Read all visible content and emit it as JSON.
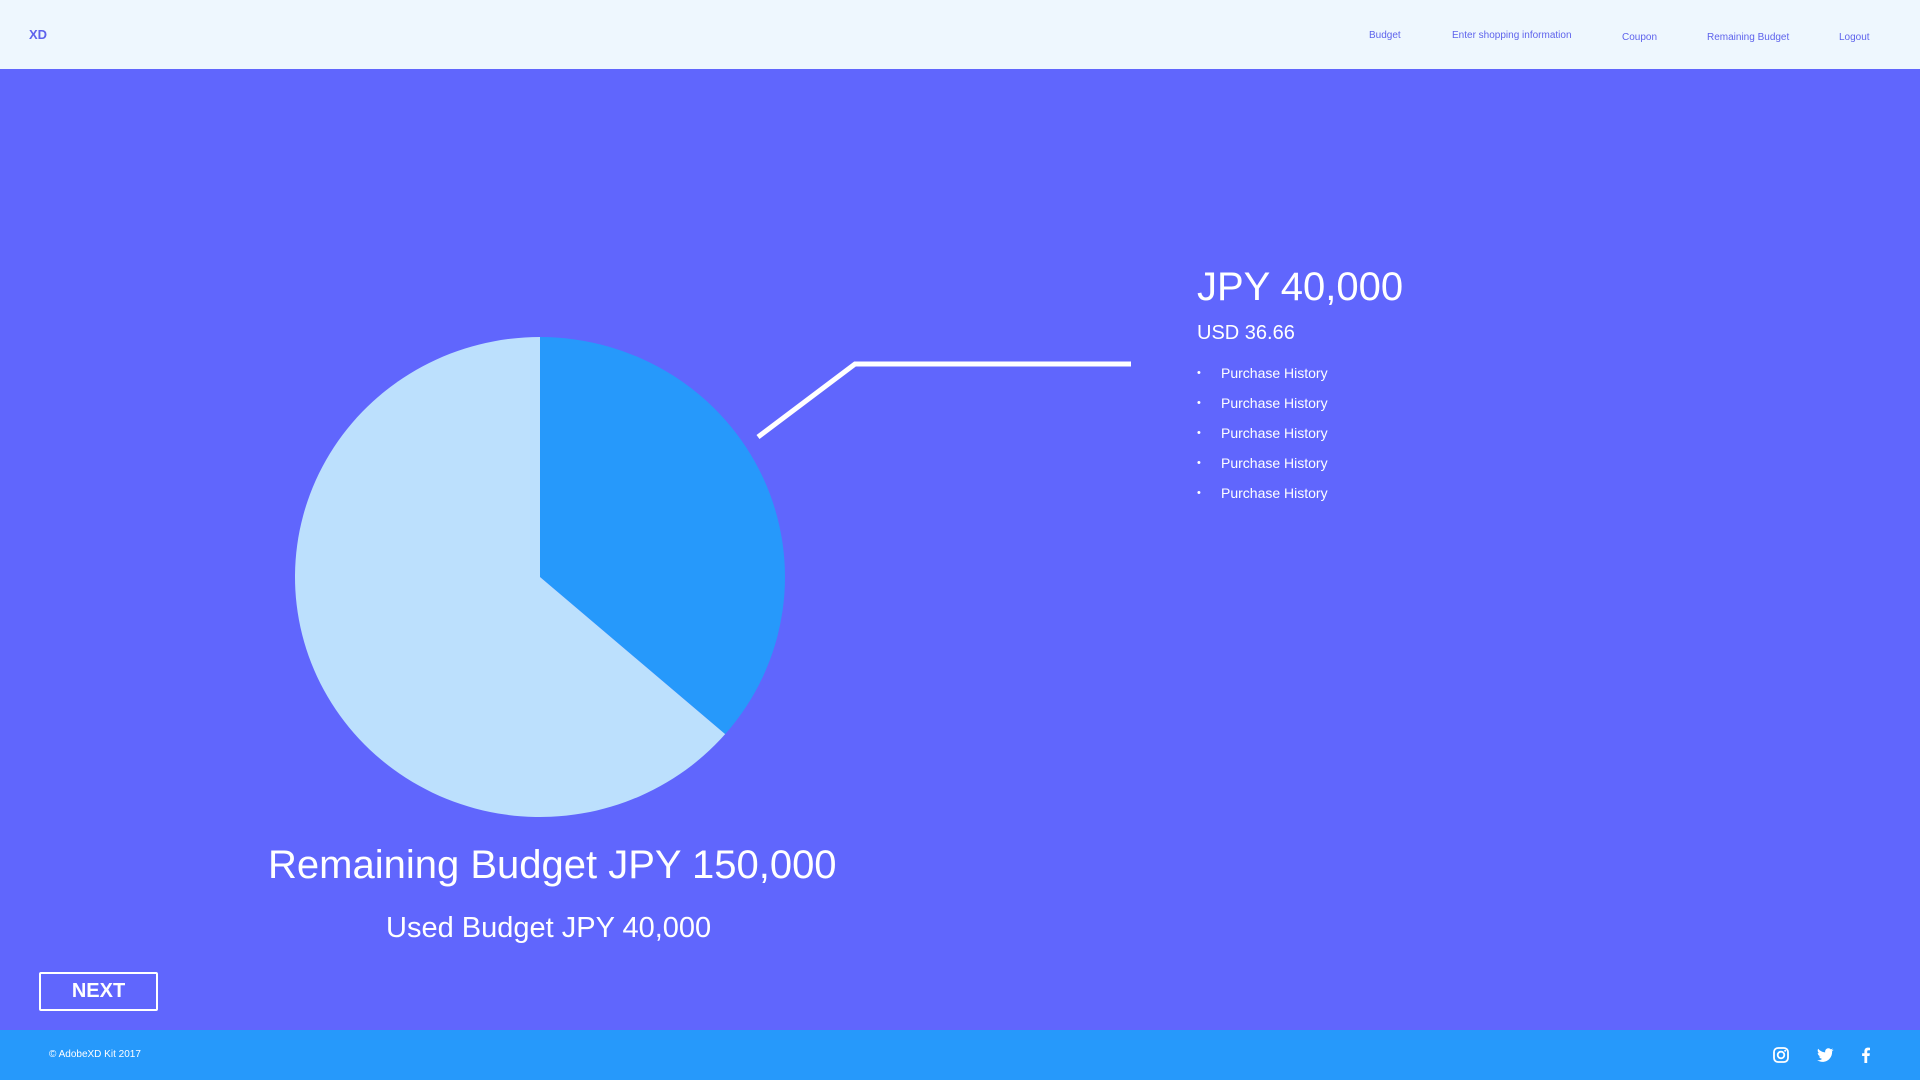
{
  "header": {
    "logo": "XD",
    "nav": [
      "Budget",
      "Enter shopping information",
      "Coupon",
      "Remaining Budget",
      "Logout"
    ]
  },
  "chart_data": {
    "type": "pie",
    "slices": [
      {
        "label": "Used Budget",
        "value": 40000,
        "color": "#2699fb"
      },
      {
        "label": "Remaining Budget",
        "value": 70000,
        "color": "#bce0fd"
      }
    ]
  },
  "callout": {
    "amount": "JPY 40,000",
    "usd": "USD 36.66",
    "history": [
      "Purchase History",
      "Purchase History",
      "Purchase History",
      "Purchase History",
      "Purchase History"
    ]
  },
  "summary": {
    "remaining": "Remaining Budget JPY 150,000",
    "used": "Used Budget JPY 40,000"
  },
  "next_label": "NEXT",
  "footer": {
    "copyright": "© AdobeXD Kit 2017",
    "social": [
      "instagram-icon",
      "twitter-icon",
      "facebook-icon"
    ]
  },
  "colors": {
    "background": "#6066fd",
    "header_bg": "#eef7fe",
    "footer_bg": "#2699fb",
    "accent_text": "#5e63ec"
  }
}
